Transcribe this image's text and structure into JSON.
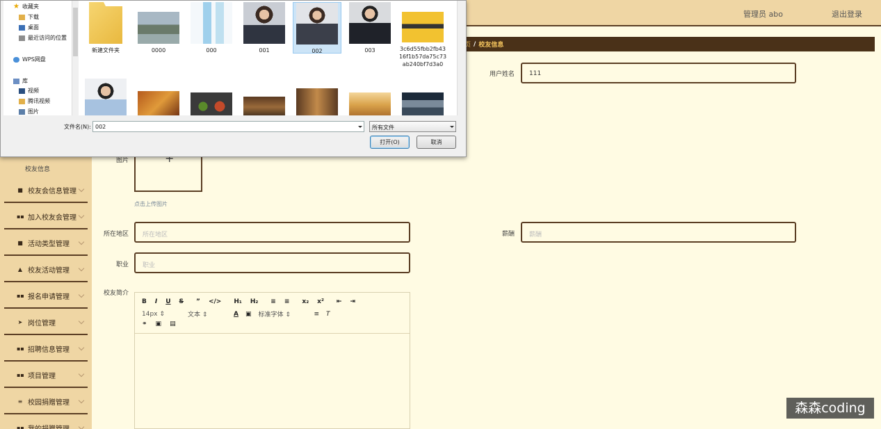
{
  "header": {
    "user_label": "管理员 abo",
    "logout_label": "退出登录"
  },
  "breadcrumb": {
    "home": "页",
    "current": "校友信息"
  },
  "sidebar": {
    "sub_label": "校友信息",
    "items": [
      {
        "label": "校友会信息管理",
        "icon": "briefcase-icon"
      },
      {
        "label": "加入校友会管理",
        "icon": "grid-icon"
      },
      {
        "label": "活动类型管理",
        "icon": "clipboard-icon"
      },
      {
        "label": "校友活动管理",
        "icon": "thumbs-up-icon"
      },
      {
        "label": "报名申请管理",
        "icon": "grid-icon"
      },
      {
        "label": "岗位管理",
        "icon": "paper-plane-icon"
      },
      {
        "label": "招聘信息管理",
        "icon": "grid-icon"
      },
      {
        "label": "项目管理",
        "icon": "grid-icon"
      },
      {
        "label": "校园捐赠管理",
        "icon": "list-icon"
      },
      {
        "label": "我的捐赠管理",
        "icon": "grid-icon"
      }
    ]
  },
  "form": {
    "username_label": "用户姓名",
    "username_value": "111",
    "photo_label": "图片",
    "upload_hint": "点击上传图片",
    "region_label": "所在地区",
    "region_placeholder": "所在地区",
    "salary_label": "薪酬",
    "salary_placeholder": "薪酬",
    "job_label": "职业",
    "job_placeholder": "职业",
    "intro_label": "校友简介"
  },
  "editor": {
    "font_size": "14px",
    "paragraph": "文本",
    "font_family": "标准字体"
  },
  "dialog": {
    "nav": {
      "favorites": "收藏夹",
      "downloads": "下载",
      "desktop": "桌面",
      "recent": "最近访问的位置",
      "wps": "WPS网盘",
      "library": "库",
      "videos": "视频",
      "tencent_video": "腾讯视频",
      "pictures": "图片"
    },
    "files": [
      {
        "name": "新建文件夹",
        "kind": "folder"
      },
      {
        "name": "0000",
        "kind": "image"
      },
      {
        "name": "000",
        "kind": "image"
      },
      {
        "name": "001",
        "kind": "image"
      },
      {
        "name": "002",
        "kind": "image",
        "selected": true
      },
      {
        "name": "003",
        "kind": "image"
      },
      {
        "name": "3c6d55fbb2fb4316f1b57da75c73ab240bf7d3a0",
        "kind": "image"
      }
    ],
    "filename_label": "文件名(N):",
    "filename_value": "002",
    "filetype_value": "所有文件",
    "open_label": "打开(O)",
    "cancel_label": "取消"
  },
  "watermark": "森森coding"
}
